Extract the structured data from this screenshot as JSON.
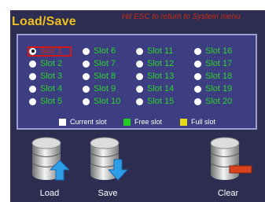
{
  "header": {
    "title": "Load/Save",
    "esc_hint": "Hit ESC to return to System menu"
  },
  "slots": [
    "Slot 1",
    "Slot 2",
    "Slot 3",
    "Slot 4",
    "Slot 5",
    "Slot 6",
    "Slot 7",
    "Slot 8",
    "Slot 9",
    "Slot 10",
    "Slot 11",
    "Slot 12",
    "Slot 13",
    "Slot 14",
    "Slot 15",
    "Slot 16",
    "Slot 17",
    "Slot 18",
    "Slot 19",
    "Slot 20"
  ],
  "selected_slot": "Slot 1",
  "legend": {
    "current": "Current slot",
    "free": "Free slot",
    "full": "Full slot"
  },
  "actions": {
    "load": "Load",
    "save": "Save",
    "clear": "Clear"
  },
  "icons": {
    "load": "database-upload-icon",
    "save": "database-download-icon",
    "clear": "database-remove-icon"
  },
  "colors": {
    "title": "#f0c020",
    "esc_hint": "#c82a14",
    "background": "#2d2d52",
    "panel": "#3d3d82",
    "panel_border": "#9e9ed2",
    "free_slot": "#2cd22c",
    "current_slot": "#c82a14",
    "legend_current": "#ffffff",
    "legend_free": "#22cc22",
    "legend_full": "#e8d81c",
    "arrow_up": "#2f9ee8",
    "arrow_down": "#2f9ee8",
    "remove_bar": "#d8421c"
  }
}
